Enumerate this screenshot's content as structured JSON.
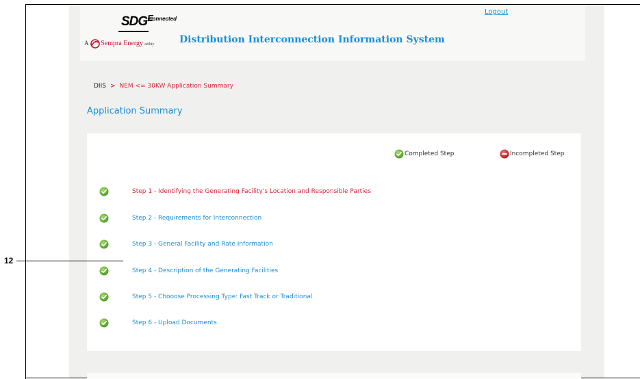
{
  "header": {
    "logo_main": "SDG",
    "logo_e": "E",
    "logo_connected": "connected",
    "logo_tagline_prefix": "A",
    "logo_tagline_brand": "Sempra Energy",
    "logo_tagline_suffix": "utility",
    "system_title": "Distribution Interconnection Information System",
    "logout_label": "Logout"
  },
  "breadcrumb": {
    "root": "DIIS",
    "separator": ">",
    "current": "NEM <= 30KW Application Summary"
  },
  "page_title": "Application Summary",
  "legend": {
    "completed": "Completed Step",
    "incompleted": "Incompleted Step"
  },
  "steps": [
    {
      "label": "Step 1 - Identifying the Generating Facility's Location and Responsible Parties",
      "status": "completed"
    },
    {
      "label": "Step 2 - Requirements for Interconnection",
      "status": "completed"
    },
    {
      "label": "Step 3 - General Facility and Rate Information",
      "status": "completed"
    },
    {
      "label": "Step 4 - Description of the Generating Facilities",
      "status": "completed"
    },
    {
      "label": "Step 5 - Chooose Processing Type: Fast Track or Traditional",
      "status": "completed"
    },
    {
      "label": "Step 6 - Upload Documents",
      "status": "completed"
    }
  ],
  "callout": "12",
  "colors": {
    "link_blue": "#1b8ed8",
    "active_red": "#d9253a",
    "complete_green": "#6cb33f",
    "incomplete_red": "#d71f26"
  },
  "icons": {
    "completed": "check-circle-icon",
    "incompleted": "minus-circle-icon"
  }
}
